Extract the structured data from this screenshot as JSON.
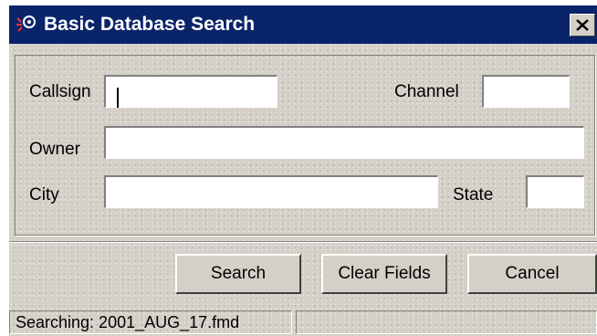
{
  "window": {
    "title": "Basic Database Search",
    "app_icon": "app-icon",
    "close_icon": "close-icon"
  },
  "form": {
    "callsign": {
      "label": "Callsign",
      "value": ""
    },
    "channel": {
      "label": "Channel",
      "value": ""
    },
    "owner": {
      "label": "Owner",
      "value": ""
    },
    "city": {
      "label": "City",
      "value": ""
    },
    "state": {
      "label": "State",
      "value": ""
    }
  },
  "buttons": {
    "search": "Search",
    "clear_fields": "Clear Fields",
    "cancel": "Cancel"
  },
  "status": {
    "text": "Searching: 2001_AUG_17.fmd",
    "secondary": ""
  },
  "colors": {
    "titlebar": "#0a246a",
    "face": "#d4d0c8",
    "field": "#ffffff"
  }
}
